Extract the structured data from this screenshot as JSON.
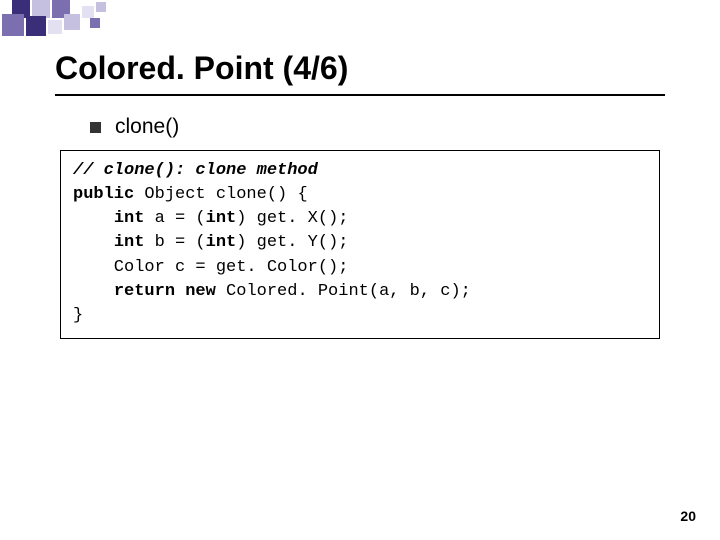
{
  "slide": {
    "title": "Colored. Point (4/6)",
    "bullet": "clone()",
    "page_number": "20"
  },
  "code": {
    "comment": "// clone(): clone method",
    "sig1": "public",
    "sig2": " Object clone() {",
    "l3a": "    ",
    "l3k": "int",
    "l3b": " a = (",
    "l3k2": "int",
    "l3c": ") get. X();",
    "l4a": "    ",
    "l4k": "int",
    "l4b": " b = (",
    "l4k2": "int",
    "l4c": ") get. Y();",
    "l5a": "    Color c = get. Color();",
    "l6a": "    ",
    "l6k": "return new",
    "l6b": " Colored. Point(a, b, c);",
    "l7": "}"
  },
  "decor": {
    "colors": {
      "dark": "#3b2e78",
      "mid": "#7b6fb0",
      "light": "#c5bfe0",
      "pale": "#e3e0f2"
    }
  }
}
